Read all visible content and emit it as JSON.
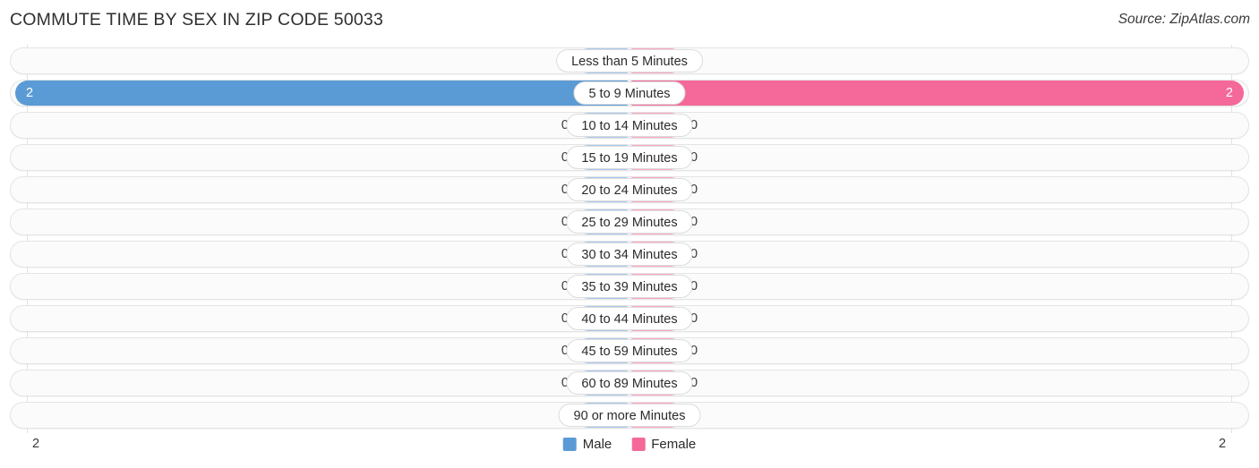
{
  "header": {
    "title": "COMMUTE TIME BY SEX IN ZIP CODE 50033",
    "source": "Source: ZipAtlas.com"
  },
  "colors": {
    "male": "#5b9bd5",
    "male_muted": "#a8c8ec",
    "female": "#f4689a",
    "female_muted": "#fba6c4"
  },
  "axis": {
    "left_tick": "2",
    "right_tick": "2"
  },
  "legend": {
    "items": [
      {
        "label": "Male",
        "color": "#5b9bd5",
        "swatch": "legend-swatch-male"
      },
      {
        "label": "Female",
        "color": "#f4689a",
        "swatch": "legend-swatch-female"
      }
    ]
  },
  "chart_data": {
    "type": "bar",
    "title": "COMMUTE TIME BY SEX IN ZIP CODE 50033",
    "subtitle": "",
    "xlabel": "",
    "ylabel": "",
    "orientation": "horizontal-diverging",
    "grid": true,
    "legend_position": "bottom-center",
    "axis_max": 2,
    "xlim": [
      2,
      2
    ],
    "categories": [
      "Less than 5 Minutes",
      "5 to 9 Minutes",
      "10 to 14 Minutes",
      "15 to 19 Minutes",
      "20 to 24 Minutes",
      "25 to 29 Minutes",
      "30 to 34 Minutes",
      "35 to 39 Minutes",
      "40 to 44 Minutes",
      "45 to 59 Minutes",
      "60 to 89 Minutes",
      "90 or more Minutes"
    ],
    "series": [
      {
        "name": "Male",
        "color": "#5b9bd5",
        "values": [
          0,
          2,
          0,
          0,
          0,
          0,
          0,
          0,
          0,
          0,
          0,
          0
        ]
      },
      {
        "name": "Female",
        "color": "#f4689a",
        "values": [
          0,
          2,
          0,
          0,
          0,
          0,
          0,
          0,
          0,
          0,
          0,
          0
        ]
      }
    ]
  },
  "rows": [
    {
      "label": "Less than 5 Minutes",
      "male": "0",
      "female": "0",
      "male_pct": 0,
      "female_pct": 0,
      "highlight": false
    },
    {
      "label": "5 to 9 Minutes",
      "male": "2",
      "female": "2",
      "male_pct": 100,
      "female_pct": 100,
      "highlight": true
    },
    {
      "label": "10 to 14 Minutes",
      "male": "0",
      "female": "0",
      "male_pct": 0,
      "female_pct": 0,
      "highlight": false
    },
    {
      "label": "15 to 19 Minutes",
      "male": "0",
      "female": "0",
      "male_pct": 0,
      "female_pct": 0,
      "highlight": false
    },
    {
      "label": "20 to 24 Minutes",
      "male": "0",
      "female": "0",
      "male_pct": 0,
      "female_pct": 0,
      "highlight": false
    },
    {
      "label": "25 to 29 Minutes",
      "male": "0",
      "female": "0",
      "male_pct": 0,
      "female_pct": 0,
      "highlight": false
    },
    {
      "label": "30 to 34 Minutes",
      "male": "0",
      "female": "0",
      "male_pct": 0,
      "female_pct": 0,
      "highlight": false
    },
    {
      "label": "35 to 39 Minutes",
      "male": "0",
      "female": "0",
      "male_pct": 0,
      "female_pct": 0,
      "highlight": false
    },
    {
      "label": "40 to 44 Minutes",
      "male": "0",
      "female": "0",
      "male_pct": 0,
      "female_pct": 0,
      "highlight": false
    },
    {
      "label": "45 to 59 Minutes",
      "male": "0",
      "female": "0",
      "male_pct": 0,
      "female_pct": 0,
      "highlight": false
    },
    {
      "label": "60 to 89 Minutes",
      "male": "0",
      "female": "0",
      "male_pct": 0,
      "female_pct": 0,
      "highlight": false
    },
    {
      "label": "90 or more Minutes",
      "male": "0",
      "female": "0",
      "male_pct": 0,
      "female_pct": 0,
      "highlight": false
    }
  ]
}
